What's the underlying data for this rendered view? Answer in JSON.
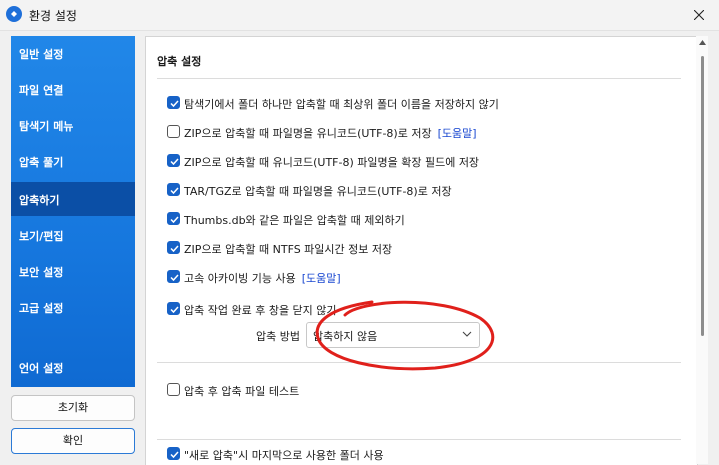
{
  "window": {
    "title": "환경 설정"
  },
  "sidebar": {
    "items": [
      {
        "label": "일반 설정",
        "active": false
      },
      {
        "label": "파일 연결",
        "active": false
      },
      {
        "label": "탐색기 메뉴",
        "active": false
      },
      {
        "label": "압축 풀기",
        "active": false
      },
      {
        "label": "압축하기",
        "active": true
      },
      {
        "label": "보기/편집",
        "active": false
      },
      {
        "label": "보안 설정",
        "active": false
      },
      {
        "label": "고급 설정",
        "active": false
      },
      {
        "label": "언어 설정",
        "active": false
      }
    ]
  },
  "buttons": {
    "reset": "초기화",
    "ok": "확인"
  },
  "panel": {
    "title": "압축 설정",
    "options": [
      {
        "label": "탐색기에서 폴더 하나만 압축할 때 최상위 폴더 이름을 저장하지 않기",
        "checked": true
      },
      {
        "label": "ZIP으로 압축할 때 파일명을 유니코드(UTF-8)로 저장",
        "checked": false,
        "help": "[도움말]"
      },
      {
        "label": "ZIP으로 압축할 때 유니코드(UTF-8) 파일명을 확장 필드에 저장",
        "checked": true
      },
      {
        "label": "TAR/TGZ로 압축할 때 파일명을 유니코드(UTF-8)로 저장",
        "checked": true
      },
      {
        "label": "Thumbs.db와 같은 파일은 압축할 때 제외하기",
        "checked": true
      },
      {
        "label": "ZIP으로 압축할 때 NTFS 파일시간 정보 저장",
        "checked": true
      },
      {
        "label": "고속 아카이빙 기능 사용",
        "checked": true,
        "help": "[도움말]"
      },
      {
        "label": "압축 작업 완료 후 창을 닫지 않기",
        "checked": true
      }
    ],
    "method": {
      "label": "압축 방법",
      "value": "압축하지 않음"
    },
    "test_option": {
      "label": "압축 후 압축 파일 테스트",
      "checked": false
    },
    "partial_option": {
      "label": "\"새로 압축\"시 마지막으로 사용한 폴더 사용",
      "checked": true
    }
  },
  "colors": {
    "sidebar": "#1677de",
    "sidebar_active": "#0b4fa6",
    "checkbox": "#1762c7",
    "link": "#1a48d1",
    "annotation": "#e0201b"
  }
}
